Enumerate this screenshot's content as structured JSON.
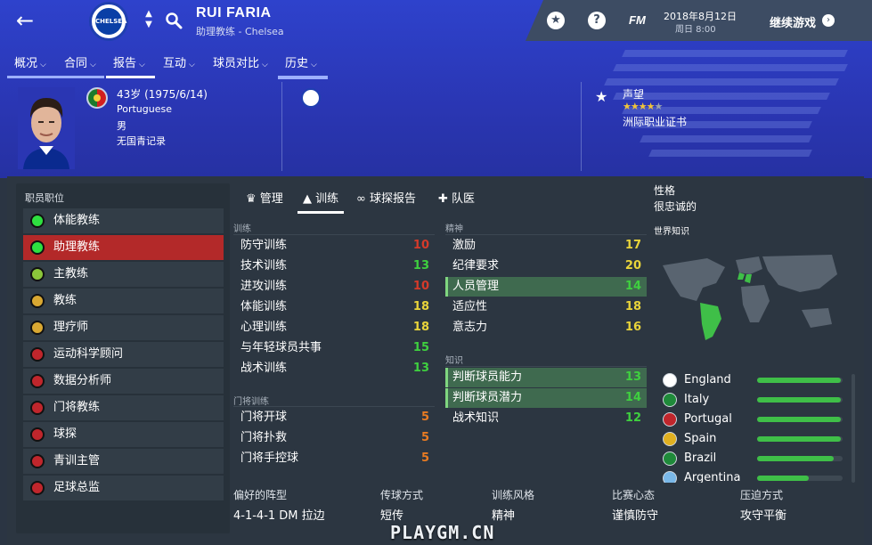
{
  "header": {
    "name": "RUI FARIA",
    "role": "助理教练 - Chelsea",
    "club_badge_text": "CHELSEA",
    "date": "2018年8月12日",
    "time": "周日 8:00",
    "fm_label": "FM",
    "help_label": "?",
    "continue_label": "继续游戏"
  },
  "nav": {
    "tabs": [
      {
        "label": "概况"
      },
      {
        "label": "合同"
      },
      {
        "label": "报告"
      },
      {
        "label": "互动"
      },
      {
        "label": "球员对比"
      },
      {
        "label": "历史"
      }
    ]
  },
  "profile": {
    "age": "43岁 (1975/6/14)",
    "nationality": "Portuguese",
    "gender": "男",
    "youth": "无国青记录",
    "reputation_label": "声望",
    "reputation_stars": 4.5,
    "license": "洲际职业证书"
  },
  "roles": {
    "header": "职员职位",
    "items": [
      {
        "label": "体能教练",
        "color": "#2ee040"
      },
      {
        "label": "助理教练",
        "color": "#2ee040"
      },
      {
        "label": "主教练",
        "color": "#8bc63a"
      },
      {
        "label": "教练",
        "color": "#d9a832"
      },
      {
        "label": "理疗师",
        "color": "#d9a832"
      },
      {
        "label": "运动科学顾问",
        "color": "#c0262c"
      },
      {
        "label": "数据分析师",
        "color": "#c0262c"
      },
      {
        "label": "门将教练",
        "color": "#c0262c"
      },
      {
        "label": "球探",
        "color": "#c0262c"
      },
      {
        "label": "青训主管",
        "color": "#c0262c"
      },
      {
        "label": "足球总监",
        "color": "#c0262c"
      }
    ]
  },
  "center_tabs": [
    {
      "label": "管理"
    },
    {
      "label": "训练"
    },
    {
      "label": "球探报告"
    },
    {
      "label": "队医"
    }
  ],
  "training": {
    "header": "训练",
    "items": [
      {
        "label": "防守训练",
        "value": "10",
        "color": "#d53a2a"
      },
      {
        "label": "技术训练",
        "value": "13",
        "color": "#3fd03f"
      },
      {
        "label": "进攻训练",
        "value": "10",
        "color": "#d53a2a"
      },
      {
        "label": "体能训练",
        "value": "18",
        "color": "#e9d43a"
      },
      {
        "label": "心理训练",
        "value": "18",
        "color": "#e9d43a"
      },
      {
        "label": "与年轻球员共事",
        "value": "15",
        "color": "#3fd03f"
      },
      {
        "label": "战术训练",
        "value": "13",
        "color": "#3fd03f"
      }
    ]
  },
  "gk_training": {
    "header": "门将训练",
    "items": [
      {
        "label": "门将开球",
        "value": "5",
        "color": "#e87b22"
      },
      {
        "label": "门将扑救",
        "value": "5",
        "color": "#e87b22"
      },
      {
        "label": "门将手控球",
        "value": "5",
        "color": "#e87b22"
      }
    ]
  },
  "mental": {
    "header": "精神",
    "items": [
      {
        "label": "激励",
        "value": "17",
        "color": "#e9d43a"
      },
      {
        "label": "纪律要求",
        "value": "20",
        "color": "#e9d43a"
      },
      {
        "label": "人员管理",
        "value": "14",
        "color": "#3fd03f"
      },
      {
        "label": "适应性",
        "value": "18",
        "color": "#e9d43a"
      },
      {
        "label": "意志力",
        "value": "16",
        "color": "#e9d43a"
      }
    ]
  },
  "knowledge": {
    "header": "知识",
    "items": [
      {
        "label": "判断球员能力",
        "value": "13",
        "color": "#3fd03f"
      },
      {
        "label": "判断球员潜力",
        "value": "14",
        "color": "#3fd03f"
      },
      {
        "label": "战术知识",
        "value": "12",
        "color": "#3fd03f"
      }
    ]
  },
  "personality": {
    "label": "性格",
    "value": "很忠诚的"
  },
  "world_knowledge": {
    "label": "世界知识",
    "nations": [
      {
        "name": "England",
        "level": 0.98
      },
      {
        "name": "Italy",
        "level": 0.98
      },
      {
        "name": "Portugal",
        "level": 0.98
      },
      {
        "name": "Spain",
        "level": 0.98
      },
      {
        "name": "Brazil",
        "level": 0.9
      },
      {
        "name": "Argentina",
        "level": 0.6
      }
    ]
  },
  "bottom": {
    "formation_label": "偏好的阵型",
    "formation_value": "4-1-4-1 DM 拉边",
    "passing_label": "传球方式",
    "passing_value": "短传",
    "style_label": "训练风格",
    "style_value": "精神",
    "mentality_label": "比赛心态",
    "mentality_value": "谨慎防守",
    "pressing_label": "压迫方式",
    "pressing_value": "攻守平衡"
  },
  "watermark": "PLAYGM.CN"
}
